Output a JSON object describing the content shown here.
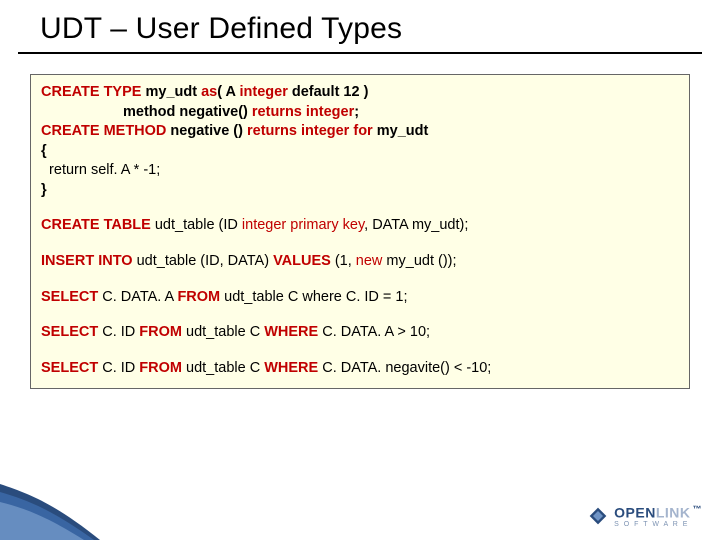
{
  "title": "UDT – User Defined Types",
  "kw": {
    "create_type": "CREATE TYPE",
    "as": "as",
    "integer": "integer",
    "returns": "returns",
    "create_method": "CREATE METHOD",
    "for": "for",
    "create_table": "CREATE TABLE",
    "primary_key": "primary key",
    "insert_into": "INSERT INTO",
    "values": "VALUES",
    "new": "new",
    "select": "SELECT",
    "from": "FROM",
    "where_uc": "WHERE"
  },
  "line1": {
    "name": " my_udt ",
    "paren_open": "( A ",
    "default": " default 12 )"
  },
  "line2": {
    "indent_method": "method negative() ",
    "semi": ";"
  },
  "line3": {
    "neg": " negative () ",
    "target": " my_udt"
  },
  "line4": {
    "brace_open": "{"
  },
  "line5": {
    "body": "  return self. A * -1;"
  },
  "line6": {
    "brace_close": "}"
  },
  "stmt_table": {
    "tbl": " udt_table (ID ",
    "mid": ", DATA my_udt);"
  },
  "stmt_insert": {
    "a": " udt_table (ID, DATA) ",
    "b": " (1, ",
    "c": " my_udt ());"
  },
  "stmt_sel1": {
    "a": " C. DATA. A ",
    "b": " udt_table C where C. ID = 1;"
  },
  "stmt_sel2": {
    "a": " C. ID ",
    "b": " udt_table C ",
    "c": " C. DATA. A > 10;"
  },
  "stmt_sel3": {
    "a": " C. ID ",
    "b": " udt_table C ",
    "c": " C. DATA. negavite() < -10;"
  },
  "logo": {
    "word1": "OPEN",
    "word2": "LINK",
    "sub": "S O F T W A R E",
    "tm": "™"
  }
}
